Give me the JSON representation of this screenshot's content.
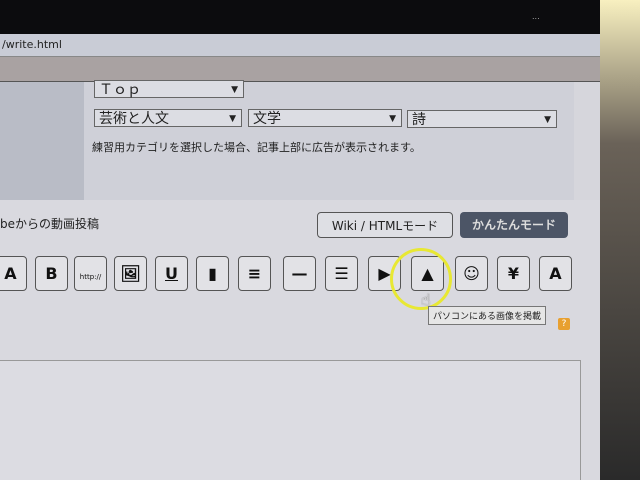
{
  "browser": {
    "url_fragment": "/write.html",
    "top_right_text": "..."
  },
  "category": {
    "top_select": "Ｔｏｐ",
    "level1": "芸術と人文",
    "level2": "文学",
    "level3": "詩",
    "note": "練習用カテゴリを選択した場合、記事上部に広告が表示されます。"
  },
  "editor": {
    "video_label": "beからの動画投稿",
    "wiki_mode": "Wiki / HTMLモード",
    "easy_mode": "かんたんモード",
    "toolbar": [
      {
        "name": "font-style",
        "glyph": "A"
      },
      {
        "name": "bold",
        "glyph": "B"
      },
      {
        "name": "link",
        "glyph": "http://"
      },
      {
        "name": "image-url",
        "glyph": "🖼"
      },
      {
        "name": "underline",
        "glyph": "U"
      },
      {
        "name": "color",
        "glyph": "▮"
      },
      {
        "name": "align",
        "glyph": "≡"
      },
      {
        "name": "horizontal-rule",
        "glyph": "—"
      },
      {
        "name": "list",
        "glyph": "☰"
      },
      {
        "name": "video-url",
        "glyph": "▶"
      },
      {
        "name": "upload-image",
        "glyph": "▲"
      },
      {
        "name": "emoji",
        "glyph": "☺"
      },
      {
        "name": "yen",
        "glyph": "¥"
      },
      {
        "name": "clear-format",
        "glyph": "A"
      }
    ],
    "tooltip": "パソコンにある画像を掲載",
    "help": "?"
  }
}
